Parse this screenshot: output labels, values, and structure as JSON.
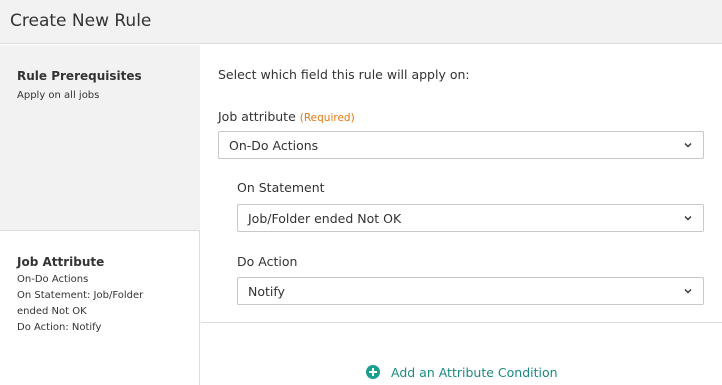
{
  "header": {
    "title": "Create New Rule"
  },
  "sidebar": {
    "prerequisites": {
      "title": "Rule Prerequisites",
      "text": "Apply on all jobs"
    },
    "job_attribute": {
      "title": "Job Attribute",
      "lines": [
        "On-Do Actions",
        "On Statement: Job/Folder",
        "ended Not OK",
        "Do Action: Notify"
      ]
    }
  },
  "main": {
    "instruction": "Select which field this rule will apply on:",
    "job_attribute": {
      "label": "Job attribute",
      "required": "(Required)",
      "value": "On-Do Actions"
    },
    "on_statement": {
      "label": "On Statement",
      "value": "Job/Folder ended Not OK"
    },
    "do_action": {
      "label": "Do Action",
      "value": "Notify"
    },
    "add_condition": {
      "label": "Add an Attribute Condition"
    }
  },
  "colors": {
    "accent": "#1a9e8f",
    "required": "#e07a10"
  }
}
